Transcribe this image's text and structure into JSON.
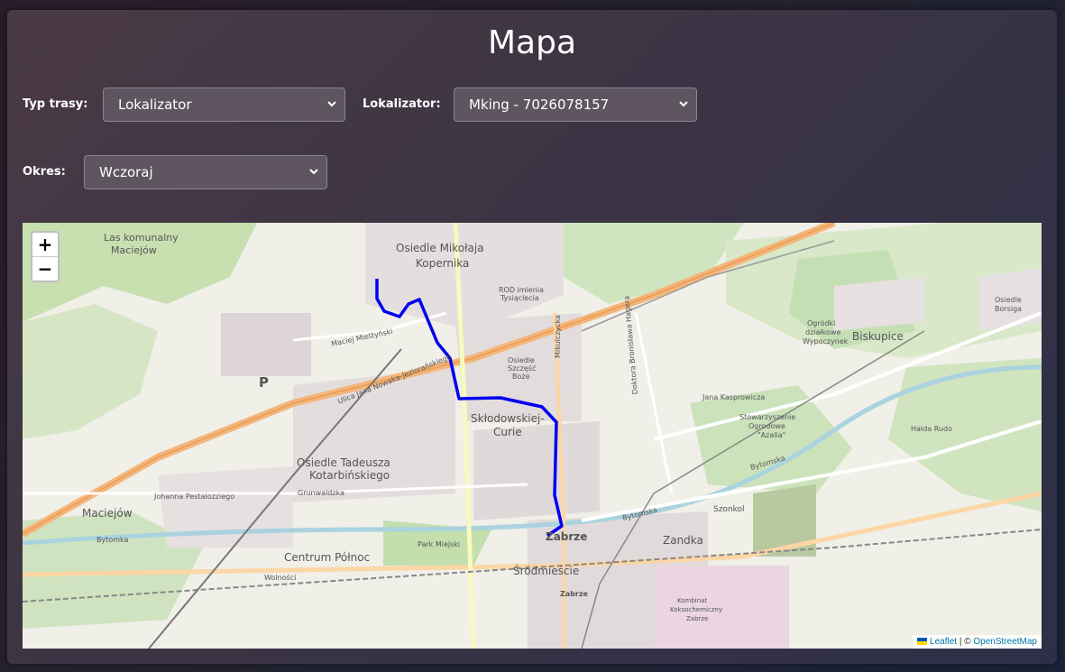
{
  "page": {
    "title": "Mapa"
  },
  "filters": {
    "route_type_label": "Typ trasy:",
    "route_type_value": "Lokalizator",
    "locator_label": "Lokalizator:",
    "locator_value": "Mking - 7026078157",
    "period_label": "Okres:",
    "period_value": "Wczoraj"
  },
  "map": {
    "zoom_in": "+",
    "zoom_out": "−",
    "attribution": {
      "leaflet": "Leaflet",
      "sep": " | © ",
      "osm": "OpenStreetMap"
    },
    "route_color": "#0000ee",
    "labels": [
      "Osiedle Mikołaja",
      "Kopernika",
      "Maciejów",
      "ROD imienia",
      "Tysiąclecia",
      "Osiedle",
      "Szczęść",
      "Boże",
      "Skłodowskiej-",
      "Curie",
      "Osiedle Tadeusza",
      "Kotarbińskiego",
      "Maciejów",
      "Centrum Północ",
      "Zabrze",
      "Śródmieście",
      "Zandka",
      "Biskupice",
      "Ogródki",
      "działkowe",
      "Wypoczynek",
      "Stowarzyszenie",
      "Ogrodowe",
      "\"Azalia\"",
      "Hałda Rudo",
      "Szonkol",
      "Park Miejski",
      "Kombinat",
      "Koksochemiczny",
      "Zabrze",
      "Osiedle",
      "Borsiga",
      "Ulica Jana Nowaka-Jeziorańskiego",
      "Maciej Mielżyński",
      "Johanna Pestalozziego",
      "Grunwaldzka",
      "Bytomka",
      "Wolności",
      "Jana Kasprowicza",
      "Bytomska",
      "Mikulczycka",
      "Doktora Bronisława Hagera",
      "Bytomska",
      "Las komunalny",
      "Maciejów",
      "Zabrze"
    ]
  }
}
